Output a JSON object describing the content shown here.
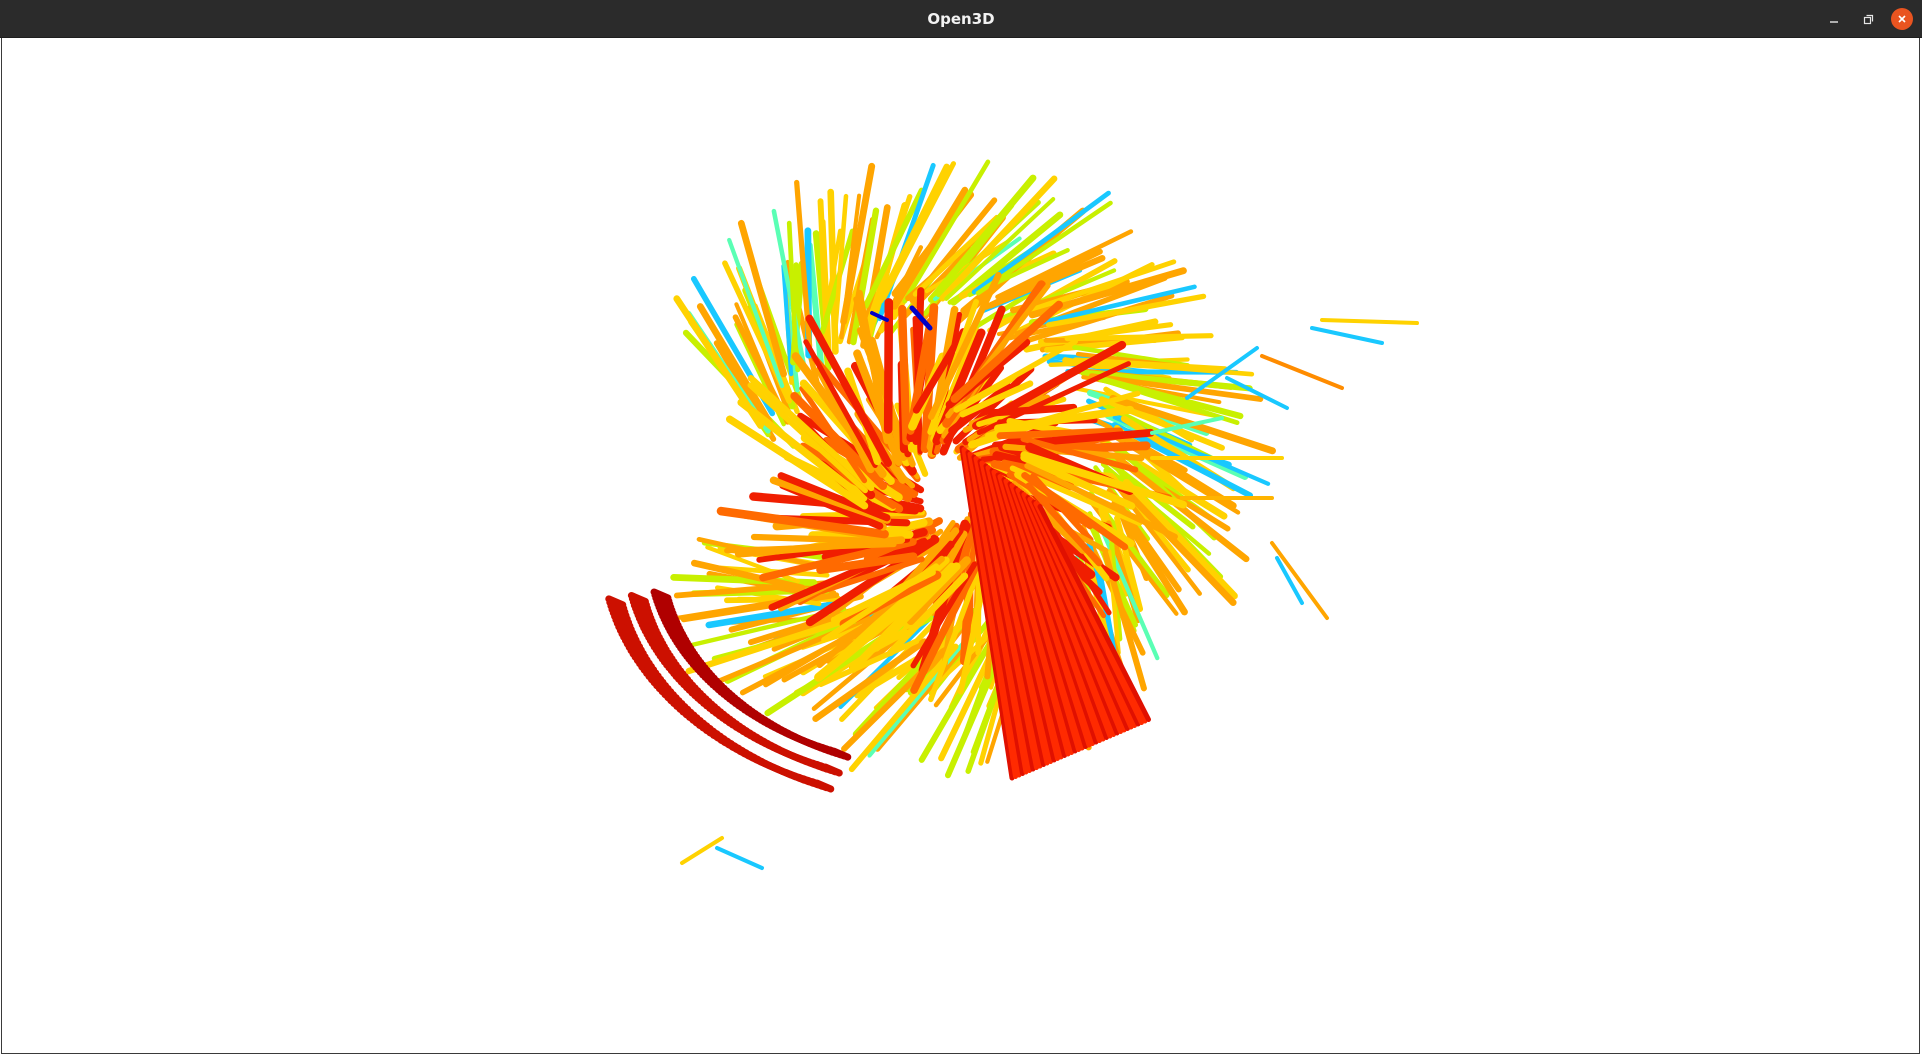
{
  "window": {
    "title": "Open3D",
    "controls": {
      "minimize_icon": "minimize-icon",
      "maximize_icon": "maximize-icon",
      "close_icon": "close-icon",
      "close_color": "#e95420"
    }
  },
  "viewport": {
    "background": "#ffffff",
    "content": "point-cloud",
    "colormap": "jet",
    "palette": [
      "#0000c8",
      "#19c8ff",
      "#5affb4",
      "#c8f000",
      "#ffd200",
      "#ffa500",
      "#ff6a00",
      "#f01e00",
      "#b40000"
    ]
  }
}
